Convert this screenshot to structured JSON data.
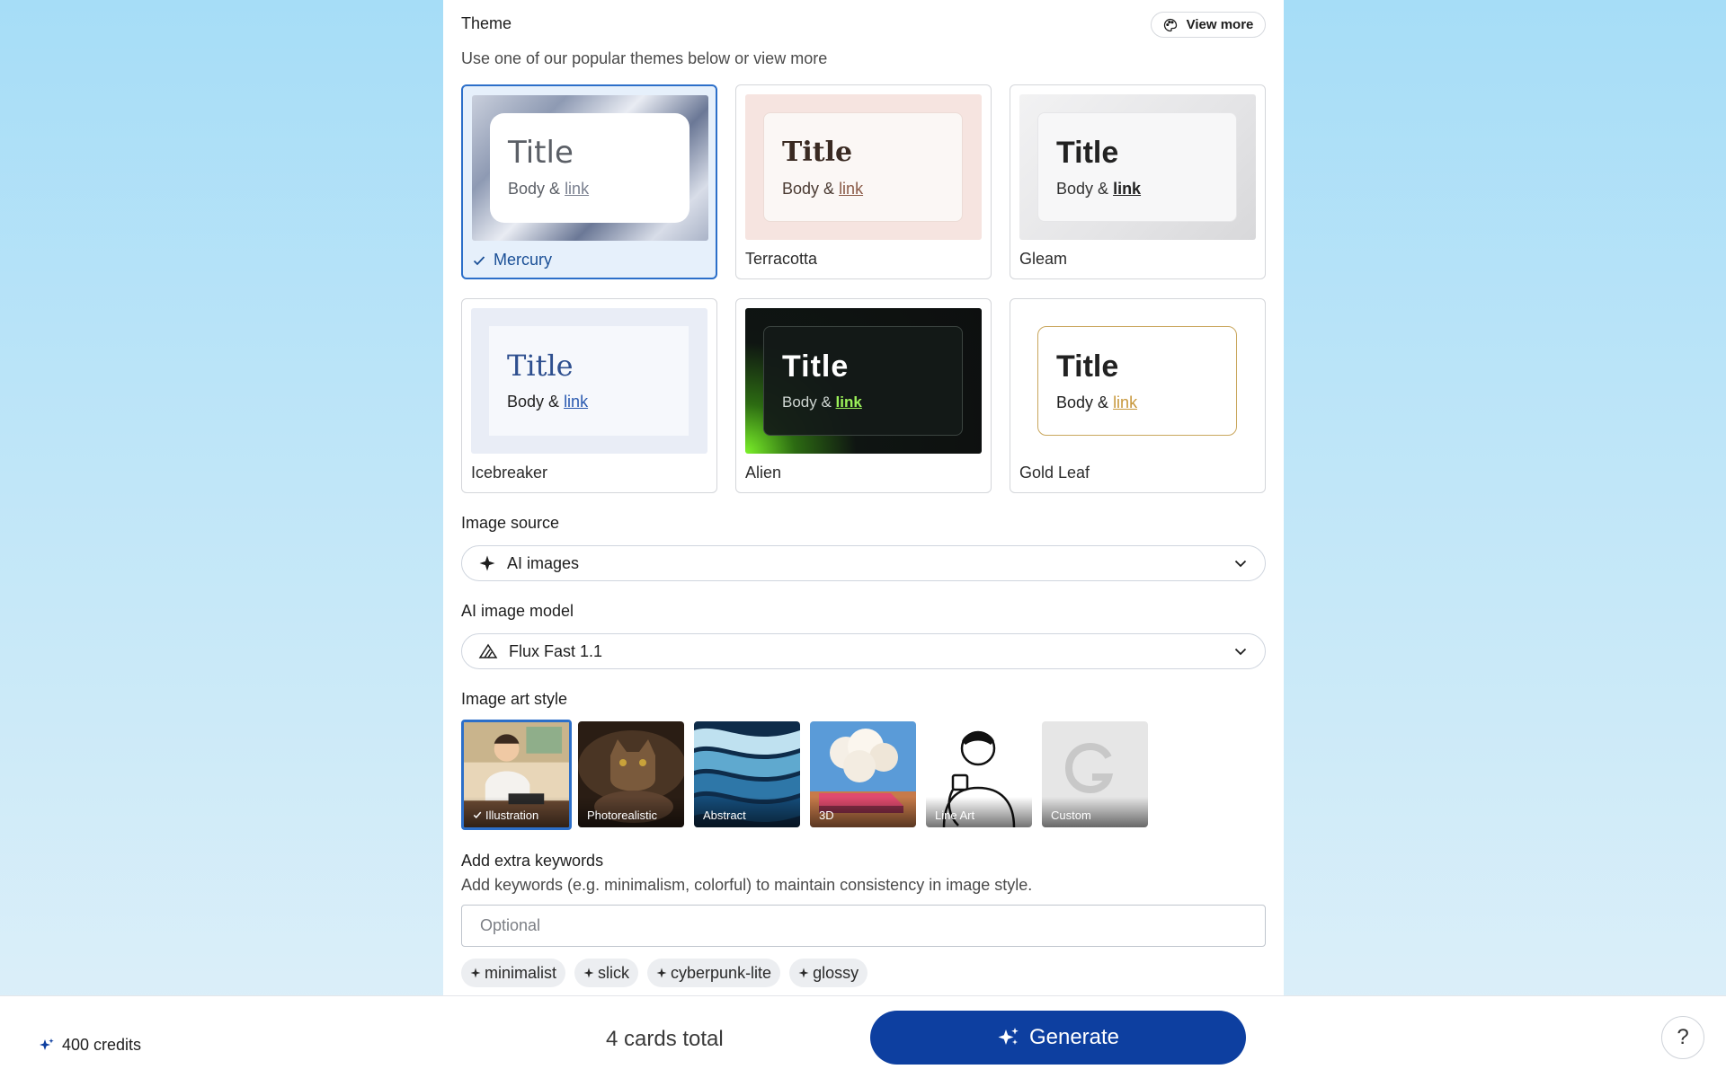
{
  "theme": {
    "title": "Theme",
    "subtitle": "Use one of our popular themes below or view more",
    "view_more": "View more",
    "preview_title": "Title",
    "preview_body": "Body &",
    "preview_link": "link",
    "cards": [
      {
        "name": "Mercury",
        "selected": true
      },
      {
        "name": "Terracotta",
        "selected": false
      },
      {
        "name": "Gleam",
        "selected": false
      },
      {
        "name": "Icebreaker",
        "selected": false
      },
      {
        "name": "Alien",
        "selected": false
      },
      {
        "name": "Gold Leaf",
        "selected": false
      }
    ]
  },
  "image_source": {
    "label": "Image source",
    "value": "AI images",
    "icon": "sparkle-icon"
  },
  "ai_model": {
    "label": "AI image model",
    "value": "Flux Fast 1.1",
    "icon": "flux-icon"
  },
  "art_style": {
    "label": "Image art style",
    "styles": [
      {
        "name": "Illustration",
        "selected": true
      },
      {
        "name": "Photorealistic",
        "selected": false
      },
      {
        "name": "Abstract",
        "selected": false
      },
      {
        "name": "3D",
        "selected": false
      },
      {
        "name": "Line Art",
        "selected": false
      },
      {
        "name": "Custom",
        "selected": false
      }
    ]
  },
  "keywords": {
    "label": "Add extra keywords",
    "hint": "Add keywords (e.g. minimalism, colorful) to maintain consistency in image style.",
    "placeholder": "Optional",
    "value": "",
    "suggestions": [
      "minimalist",
      "slick",
      "cyberpunk-lite",
      "glossy"
    ]
  },
  "footer": {
    "credits": "400 credits",
    "cards_total": "4 cards total",
    "generate": "Generate",
    "help": "?"
  },
  "colors": {
    "accent": "#2c6fc9",
    "generate_bg": "#0d3fa0"
  }
}
